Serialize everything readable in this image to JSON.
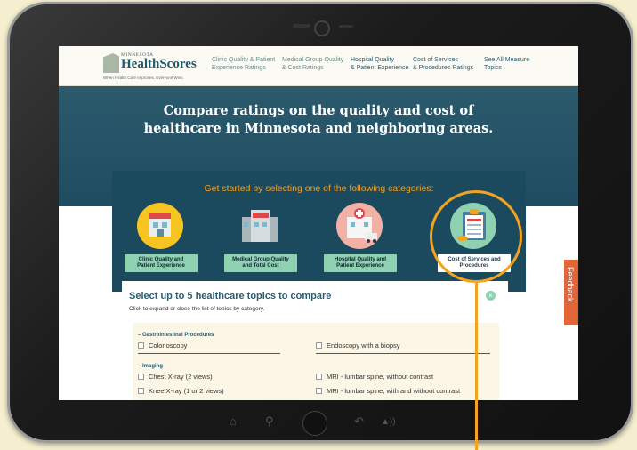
{
  "brand": {
    "small": "MINNESOTA",
    "name": "HealthScores",
    "tagline": "When Health Care Improves, Everyone Wins."
  },
  "nav": [
    {
      "line1": "Clinic Quality & Patient",
      "line2": "Experience Ratings"
    },
    {
      "line1": "Medical Group Quality",
      "line2": "& Cost Ratings"
    },
    {
      "line1": "Hospital Quality",
      "line2": "& Patient Experience"
    },
    {
      "line1": "Cost of Services",
      "line2": "& Procedures Ratings"
    },
    {
      "line1": "See All Measure",
      "line2": "Topics"
    }
  ],
  "hero": {
    "line1": "Compare ratings on the quality and cost of",
    "line2": "healthcare in Minnesota and neighboring areas."
  },
  "categories": {
    "heading": "Get started by selecting one of the following categories:",
    "items": [
      {
        "line1": "Clinic Quality and",
        "line2": "Patient Experience"
      },
      {
        "line1": "Medical Group Quality",
        "line2": "and Total Cost"
      },
      {
        "line1": "Hospital Quality and",
        "line2": "Patient Experience"
      },
      {
        "line1": "Cost of Services and",
        "line2": "Procedures"
      }
    ]
  },
  "compare": {
    "title": "Select up to 5 healthcare topics to compare",
    "subtitle": "Click to expand or close the list of topics by category.",
    "close": "×",
    "groups": [
      {
        "label": "– Gastrointestinal Procedures",
        "options": [
          "Colonoscopy",
          "Endoscopy with a biopsy"
        ]
      },
      {
        "label": "– Imaging",
        "options": [
          "Chest X-ray (2 views)",
          "MRI - lumbar spine, without contrast",
          "Knee X-ray (1 or 2 views)",
          "MRI - lumbar spine, with and without contrast"
        ]
      }
    ]
  },
  "feedback": "Feedback",
  "colors": {
    "accent": "#f3a31f",
    "teal": "#2b5d70",
    "mint": "#8ed2b2",
    "feedback": "#e2663a"
  }
}
